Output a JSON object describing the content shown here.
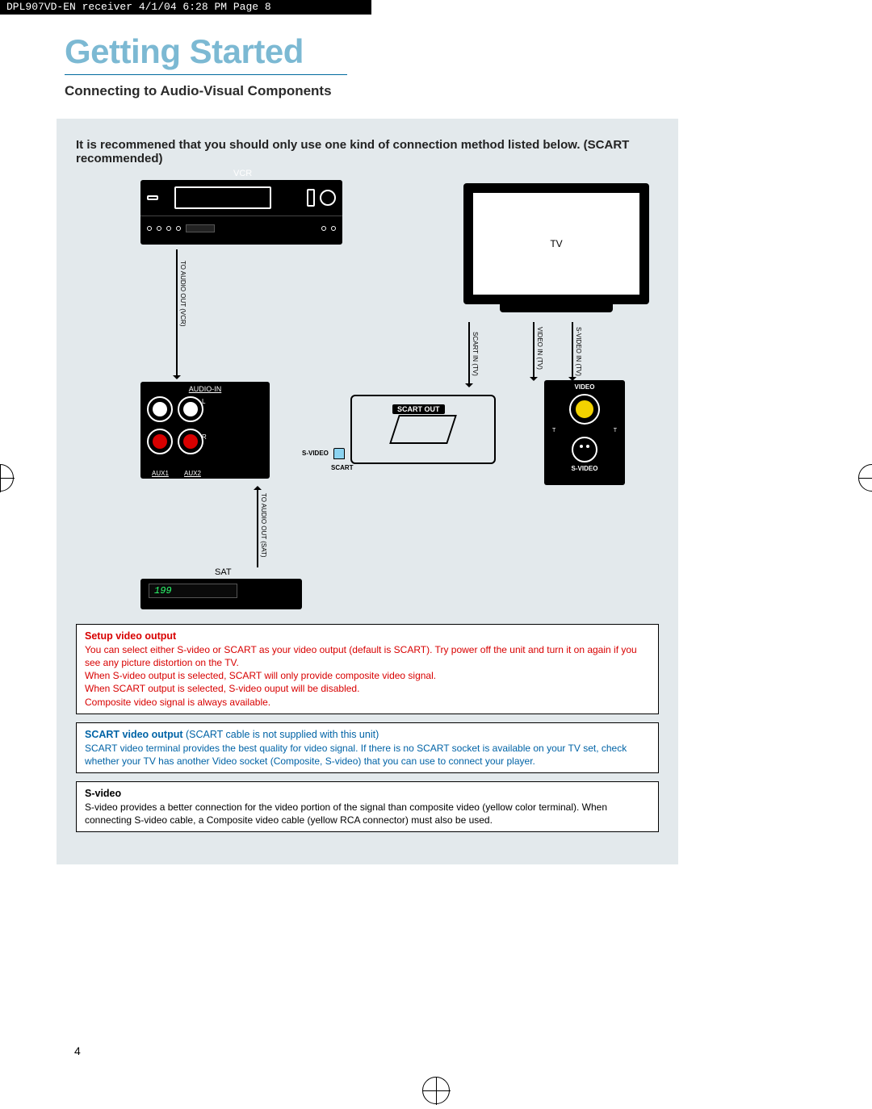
{
  "meta": {
    "slug": "DPL907VD-EN  receiver  4/1/04  6:28 PM  Page 8"
  },
  "page": {
    "title": "Getting Started",
    "subtitle": "Connecting to Audio-Visual Components",
    "recommendation": "It is recommened that you should only use one kind of connection method listed below. (SCART recommended)",
    "page_number": "4"
  },
  "diagram": {
    "vcr_label": "VCR",
    "tv_label": "TV",
    "sat_label": "SAT",
    "sat_display": "199",
    "audio_in": "AUDIO-IN",
    "aux1": "AUX1",
    "aux2": "AUX2",
    "l_label": "L",
    "r_label": "R",
    "s_video_port": "S-VIDEO",
    "scart_port": "SCART",
    "scart_out": "SCART OUT",
    "video_label": "VIDEO",
    "s_video_label": "S-VIDEO",
    "out_t_left": "T",
    "out_t_right": "T",
    "cable_labels": {
      "to_audio_out_vcr": "TO AUDIO OUT (VCR)",
      "to_audio_out_sat": "TO AUDIO OUT (SAT)",
      "scart_in_tv": "SCART IN (TV)",
      "video_in_tv": "VIDEO IN (TV)",
      "s_video_in_tv": "S-VIDEO IN (TV)"
    }
  },
  "boxes": {
    "setup": {
      "header": "Setup video output",
      "line1": "You can select either S-video or SCART as your video output (default is SCART). Try power off the unit and turn it on again if you see any picture distortion on the TV.",
      "line2": "When S-video output is selected, SCART will only provide composite video signal.",
      "line3": "When SCART output is selected, S-video ouput will be disabled.",
      "line4": "Composite video signal is always available."
    },
    "scart": {
      "header": "SCART video output",
      "header_paren": "(SCART cable is not supplied with this unit)",
      "body": "SCART video terminal provides the best quality for video signal. If there is no SCART socket is available on your TV set, check whether your TV has another Video socket (Composite, S-video) that you can use to connect your player."
    },
    "svideo": {
      "header": "S-video",
      "body": "S-video provides a better connection for the video portion of the signal than composite video (yellow color terminal). When connecting S-video cable, a Composite video cable (yellow RCA connector) must also be used."
    }
  }
}
